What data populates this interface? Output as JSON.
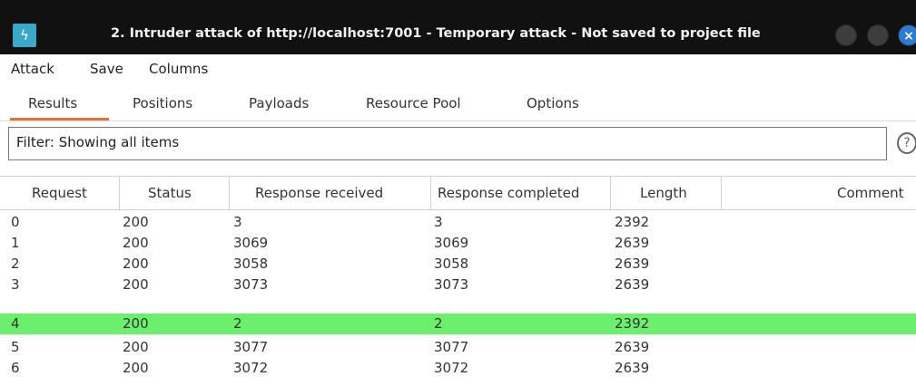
{
  "window": {
    "title": "2. Intruder attack of http://localhost:7001 - Temporary attack - Not saved to project file",
    "app_icon_glyph": "ϟ",
    "close_glyph": "×"
  },
  "menu": [
    "Attack",
    "Save",
    "Columns"
  ],
  "tabs": [
    "Results",
    "Positions",
    "Payloads",
    "Resource Pool",
    "Options"
  ],
  "active_tab": "Results",
  "filter": {
    "text": "Filter: Showing all items",
    "help_glyph": "?"
  },
  "table": {
    "columns": [
      "Request",
      "Status",
      "Response received",
      "Response completed",
      "Length",
      "Comment"
    ],
    "rows": [
      {
        "request": "0",
        "status": "200",
        "received": "3",
        "completed": "3",
        "length": "2392",
        "comment": ""
      },
      {
        "request": "1",
        "status": "200",
        "received": "3069",
        "completed": "3069",
        "length": "2639",
        "comment": ""
      },
      {
        "request": "2",
        "status": "200",
        "received": "3058",
        "completed": "3058",
        "length": "2639",
        "comment": ""
      },
      {
        "request": "3",
        "status": "200",
        "received": "3073",
        "completed": "3073",
        "length": "2639",
        "comment": ""
      },
      {
        "request": "4",
        "status": "200",
        "received": "2",
        "completed": "2",
        "length": "2392",
        "comment": ""
      },
      {
        "request": "5",
        "status": "200",
        "received": "3077",
        "completed": "3077",
        "length": "2639",
        "comment": ""
      },
      {
        "request": "6",
        "status": "200",
        "received": "3072",
        "completed": "3072",
        "length": "2639",
        "comment": ""
      }
    ],
    "selected_row_index": 4
  },
  "colors": {
    "titlebar_bg": "#111111",
    "selected_row": "#6cef6c",
    "active_tab_underline": "#e8703a",
    "app_icon_bg": "#3aa8c8",
    "close_button": "#2e7bd6"
  }
}
